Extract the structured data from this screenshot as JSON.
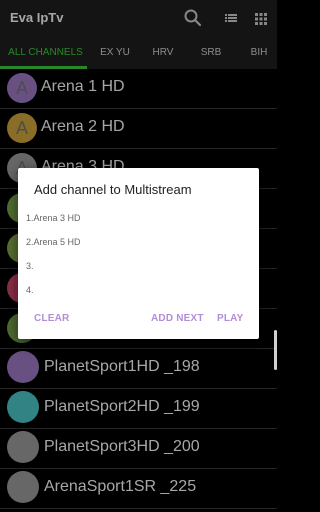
{
  "appbar": {
    "title": "Eva IpTv",
    "icons": [
      "search-icon",
      "list-view-icon",
      "grid-view-icon"
    ]
  },
  "tabs": [
    {
      "label": "ALL CHANNELS",
      "active": true
    },
    {
      "label": "EX YU",
      "active": false
    },
    {
      "label": "HRV",
      "active": false
    },
    {
      "label": "SRB",
      "active": false
    },
    {
      "label": "BIH",
      "active": false
    }
  ],
  "channels": [
    {
      "initial": "A",
      "name": "Arena 1 HD",
      "color": "#a07dc8"
    },
    {
      "initial": "A",
      "name": "Arena 2 HD",
      "color": "#d4a83b"
    },
    {
      "initial": "A",
      "name": "Arena 3 HD",
      "color": "#9e9e9e"
    },
    {
      "initial": "",
      "name": "",
      "color": "#7fae4f"
    },
    {
      "initial": "",
      "name": "",
      "color": "#8ab04d"
    },
    {
      "initial": "",
      "name": "",
      "color": "#d94a6a"
    },
    {
      "initial": "",
      "name": "",
      "color": "#7aa84a"
    },
    {
      "initial": "",
      "name": "PlanetSport1HD _198",
      "color": "#a07dc8"
    },
    {
      "initial": "",
      "name": "PlanetSport2HD _199",
      "color": "#4ec9c9"
    },
    {
      "initial": "",
      "name": "PlanetSport3HD _200",
      "color": "#9e9e9e"
    },
    {
      "initial": "",
      "name": "ArenaSport1SR _225",
      "color": "#9e9e9e"
    }
  ],
  "dialog": {
    "title": "Add channel to Multistream",
    "items": [
      "1.Arena 3 HD",
      "2.Arena 5 HD",
      "3.",
      "4."
    ],
    "clear_label": "CLEAR",
    "add_next_label": "ADD NEXT",
    "play_label": "PLAY"
  },
  "colors": {
    "accent": "#3fd03f",
    "dialog_button": "#b58cd6",
    "bar": "#1f1f1f"
  }
}
